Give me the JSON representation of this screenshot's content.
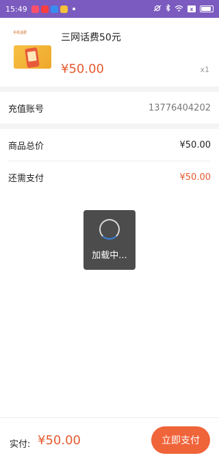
{
  "status_bar": {
    "time": "15:49",
    "battery_x": "x"
  },
  "product": {
    "thumb_label": "手机话费",
    "title": "三网话费50元",
    "price": "¥50.00",
    "qty": "x1"
  },
  "account": {
    "label": "充值账号",
    "value": "13776404202"
  },
  "summary": {
    "total_label": "商品总价",
    "total_value": "¥50.00",
    "due_label": "还需支付",
    "due_value": "¥50.00"
  },
  "loading": {
    "text": "加载中..."
  },
  "footer": {
    "pay_label": "实付:",
    "pay_amount": "¥50.00",
    "pay_button": "立即支付"
  },
  "colors": {
    "accent": "#f0643a",
    "price": "#e55a2f",
    "status_bar": "#7b5bbf"
  }
}
